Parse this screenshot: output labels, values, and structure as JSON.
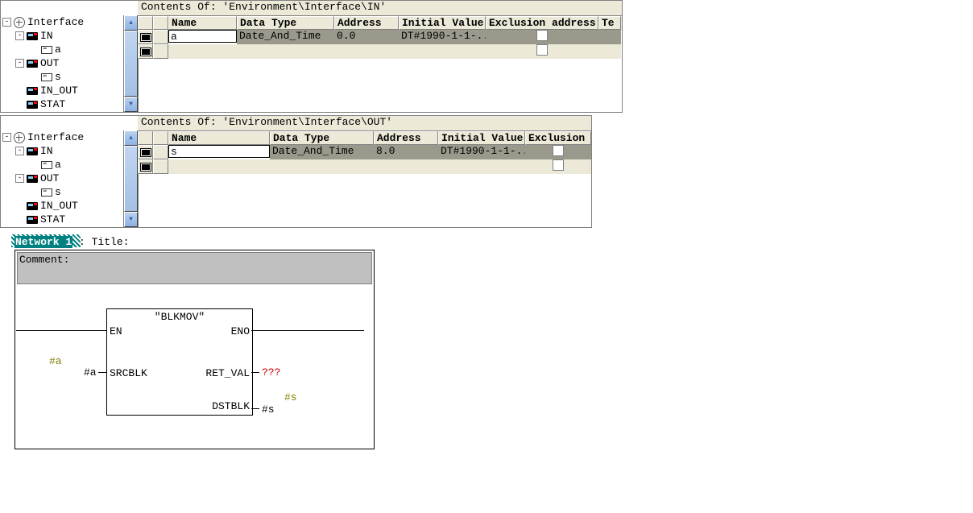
{
  "pane1": {
    "title": "Contents Of: 'Environment\\Interface\\IN'",
    "headers": [
      "",
      "Name",
      "Data Type",
      "Address",
      "Initial Value",
      "Exclusion address",
      "Te"
    ],
    "row1": {
      "name": "a",
      "type": "Date_And_Time",
      "addr": "0.0",
      "init": "DT#1990-1-1-..."
    }
  },
  "pane2": {
    "title": "Contents Of: 'Environment\\Interface\\OUT'",
    "headers": [
      "",
      "Name",
      "Data Type",
      "Address",
      "Initial Value",
      "Exclusion "
    ],
    "row1": {
      "name": "s",
      "type": "Date_And_Time",
      "addr": "8.0",
      "init": "DT#1990-1-1-..."
    }
  },
  "tree": {
    "root": "Interface",
    "n_in": "IN",
    "v_a": "a",
    "n_out": "OUT",
    "v_s": "s",
    "n_inout": "IN_OUT",
    "n_stat": "STAT"
  },
  "network": {
    "label": "Network 1",
    "title_lead": ": Title:",
    "comment_label": "Comment:",
    "block_name": "\"BLKMOV\"",
    "en": "EN",
    "eno": "ENO",
    "srcblk": "SRCBLK",
    "retval": "RET_VAL",
    "dstblk": "DSTBLK",
    "pa_hash": "#a",
    "pa": "#a",
    "ret_unk": "???",
    "ps_hash": "#s",
    "ps": "#s"
  }
}
